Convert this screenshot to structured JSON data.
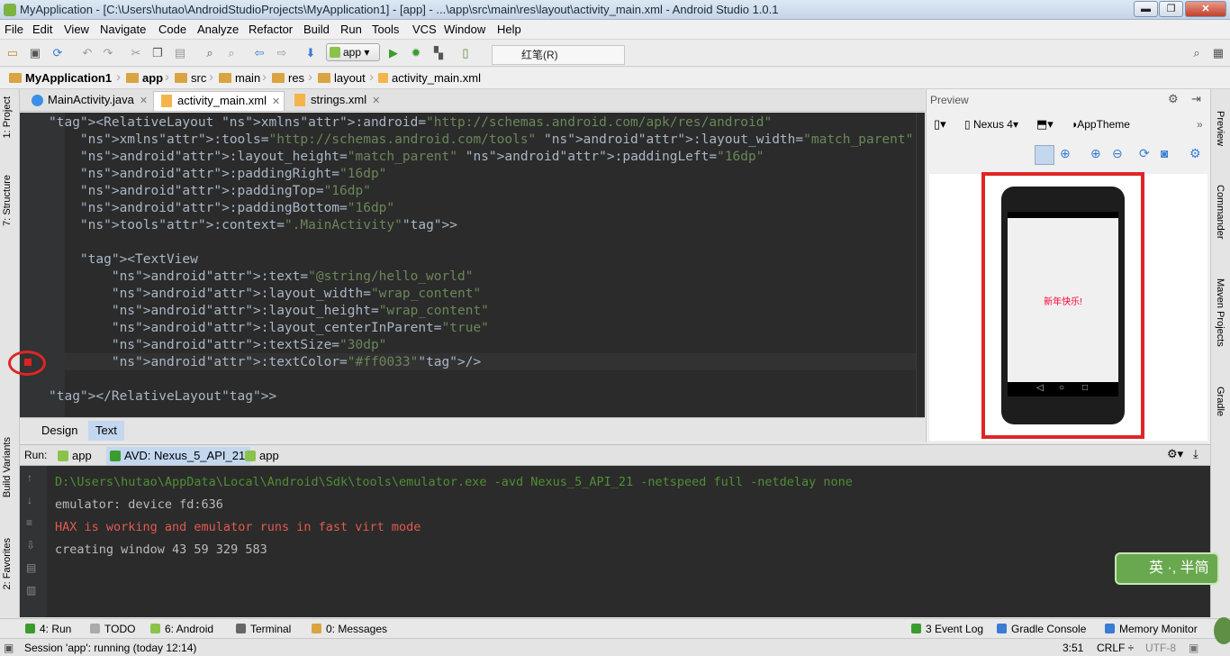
{
  "window": {
    "title": "MyApplication - [C:\\Users\\hutao\\AndroidStudioProjects\\MyApplication1] - [app] - ...\\app\\src\\main\\res\\layout\\activity_main.xml - Android Studio 1.0.1",
    "min": "▬",
    "max": "❐",
    "close": "✕"
  },
  "menu": [
    "File",
    "Edit",
    "View",
    "Navigate",
    "Code",
    "Analyze",
    "Refactor",
    "Build",
    "Run",
    "Tools",
    "VCS",
    "Window",
    "Help"
  ],
  "toolbar": {
    "run_config": "app",
    "ime_text": "红笔(R)"
  },
  "breadcrumb": [
    "MyApplication1",
    "app",
    "src",
    "main",
    "res",
    "layout",
    "activity_main.xml"
  ],
  "left_tabs": [
    "1: Project",
    "7: Structure",
    "Build Variants",
    "2: Favorites"
  ],
  "right_tabs": [
    "Preview",
    "Commander",
    "Maven Projects",
    "Gradle"
  ],
  "editor_tabs": [
    "MainActivity.java",
    "activity_main.xml",
    "strings.xml"
  ],
  "code_lines": [
    "<RelativeLayout xmlns:android=\"http://schemas.android.com/apk/res/android\"",
    "    xmlns:tools=\"http://schemas.android.com/tools\" android:layout_width=\"match_parent\"",
    "    android:layout_height=\"match_parent\" android:paddingLeft=\"16dp\"",
    "    android:paddingRight=\"16dp\"",
    "    android:paddingTop=\"16dp\"",
    "    android:paddingBottom=\"16dp\"",
    "    tools:context=\".MainActivity\">",
    "",
    "    <TextView",
    "        android:text=\"@string/hello_world\"",
    "        android:layout_width=\"wrap_content\"",
    "        android:layout_height=\"wrap_content\"",
    "        android:layout_centerInParent=\"true\"",
    "        android:textSize=\"30dp\"",
    "        android:textColor=\"#ff0033\"/>",
    "",
    "</RelativeLayout>"
  ],
  "design_tabs": {
    "design": "Design",
    "text": "Text"
  },
  "preview": {
    "title": "Preview",
    "device": "Nexus 4",
    "theme": "AppTheme",
    "hello_text": "新年快乐!"
  },
  "run": {
    "label": "Run:",
    "tabs": [
      "app",
      "AVD: Nexus_5_API_21",
      "app"
    ]
  },
  "console": [
    {
      "text": "D:\\Users\\hutao\\AppData\\Local\\Android\\Sdk\\tools\\emulator.exe -avd Nexus_5_API_21 -netspeed full -netdelay none",
      "color": "#4f8f33"
    },
    {
      "text": "emulator: device fd:636",
      "color": "#bbbbbb"
    },
    {
      "text": "HAX is working and emulator runs in fast virt mode",
      "color": "#e05a4f"
    },
    {
      "text": "creating window 43 59 329 583",
      "color": "#bbbbbb"
    }
  ],
  "watermark": "英 ·, 半简",
  "bottom_tabs": {
    "run": "4: Run",
    "todo": "TODO",
    "android": "6: Android",
    "terminal": "Terminal",
    "messages": "0: Messages",
    "eventlog": "3 Event Log",
    "gradle": "Gradle Console",
    "memory": "Memory Monitor"
  },
  "status": {
    "session": "Session 'app': running (today 12:14)",
    "pos": "3:51",
    "crlf": "CRLF ÷",
    "enc": "UTF-8"
  }
}
